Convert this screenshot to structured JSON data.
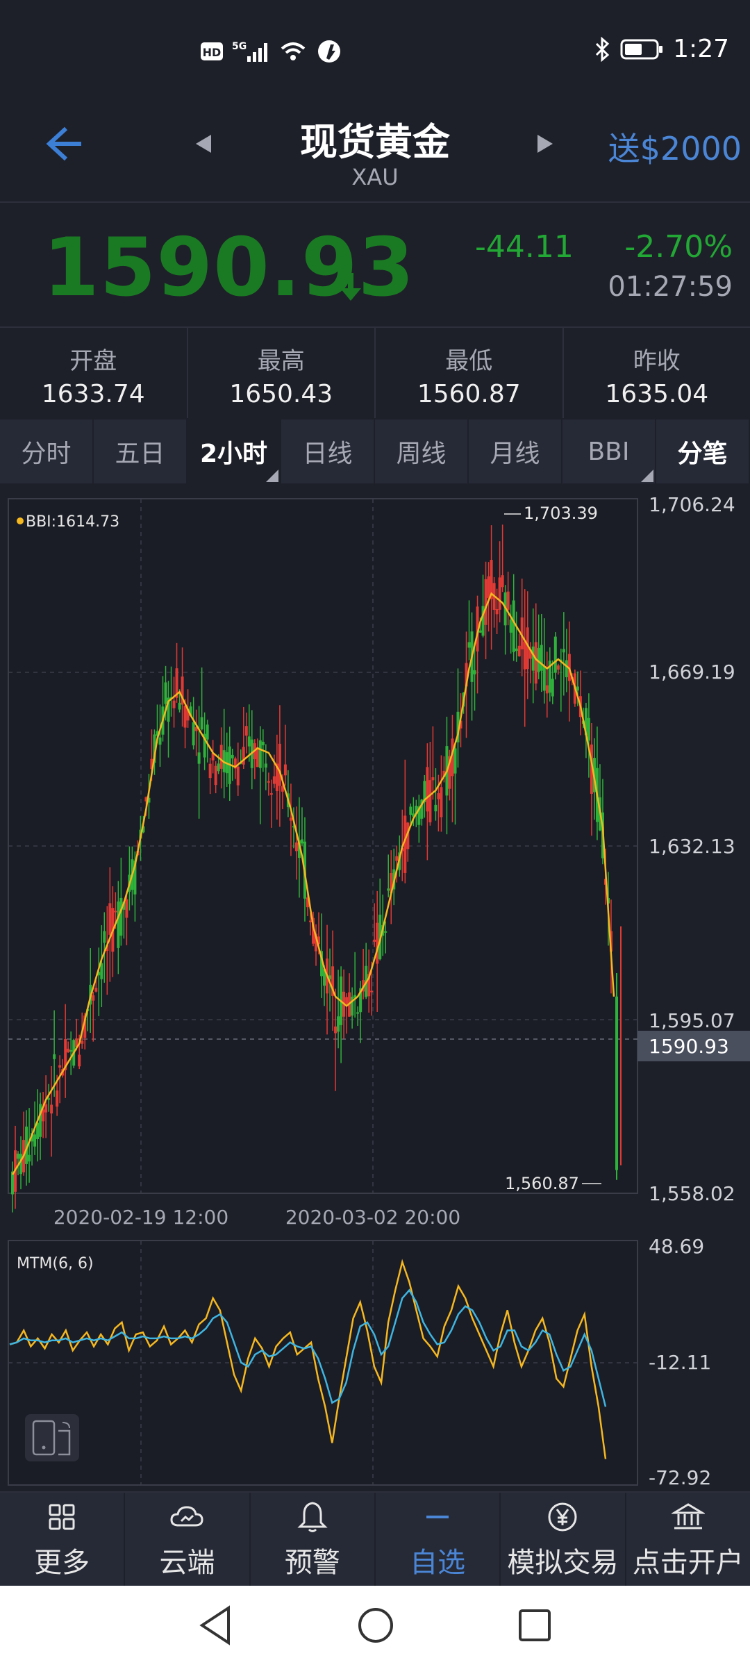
{
  "status_bar": {
    "left_icons": [
      "hd-icon",
      "5g-signal-icon",
      "wifi-icon",
      "app-notification-icon"
    ],
    "time": "1:27"
  },
  "header": {
    "title": "现货黄金",
    "subtitle": "XAU",
    "promo": "送$2000"
  },
  "quote": {
    "price": "1590.93",
    "change": "-44.11",
    "change_percent": "-2.70%",
    "time": "01:27:59",
    "down_color": "#1a7a23"
  },
  "stats": [
    {
      "label": "开盘",
      "value": "1633.74"
    },
    {
      "label": "最高",
      "value": "1650.43"
    },
    {
      "label": "最低",
      "value": "1560.87"
    },
    {
      "label": "昨收",
      "value": "1635.04"
    }
  ],
  "tabs": [
    {
      "label": "分时"
    },
    {
      "label": "五日"
    },
    {
      "label": "2小时"
    },
    {
      "label": "日线"
    },
    {
      "label": "周线"
    },
    {
      "label": "月线"
    },
    {
      "label": "BBI"
    },
    {
      "label": "分笔"
    }
  ],
  "chart_data": [
    {
      "type": "candlestick",
      "legend": "BBI:1614.73",
      "ylim": [
        1558.02,
        1706.24
      ],
      "y_ticks": [
        "1,706.24",
        "1,669.19",
        "1,632.13",
        "1,595.07",
        "1,558.02"
      ],
      "x_ticks": [
        "2020-02-19 12:00",
        "2020-03-02 20:00"
      ],
      "current_price_label": "1590.93",
      "high_annotation": "1,703.39",
      "low_annotation": "1,560.87",
      "bbi_series": [
        1562,
        1566,
        1572,
        1578,
        1582,
        1586,
        1590,
        1600,
        1608,
        1614,
        1620,
        1628,
        1640,
        1655,
        1663,
        1665,
        1660,
        1656,
        1652,
        1650,
        1649,
        1651,
        1653,
        1652,
        1648,
        1640,
        1630,
        1615,
        1606,
        1600,
        1598,
        1600,
        1604,
        1612,
        1622,
        1632,
        1638,
        1642,
        1644,
        1648,
        1656,
        1670,
        1680,
        1686,
        1684,
        1680,
        1676,
        1672,
        1670,
        1672,
        1670,
        1662,
        1650,
        1636,
        1600
      ],
      "colors": {
        "up": "#e03a35",
        "down": "#2fb13b",
        "bbi": "#f5b820"
      }
    },
    {
      "type": "line",
      "indicator": "MTM(6, 6)",
      "ylim": [
        -72.92,
        48.69
      ],
      "y_ticks": [
        "48.69",
        "-12.11",
        "-72.92"
      ],
      "series": [
        {
          "name": "MTM",
          "color": "#f5b820",
          "values": [
            -3,
            -2,
            4,
            -4,
            0,
            -5,
            2,
            -2,
            4,
            -6,
            -1,
            3,
            -4,
            2,
            -3,
            5,
            8,
            -6,
            2,
            3,
            -4,
            -1,
            6,
            -3,
            0,
            4,
            -2,
            7,
            10,
            20,
            14,
            -2,
            -18,
            -26,
            -10,
            0,
            -5,
            -14,
            -4,
            0,
            3,
            -8,
            -5,
            -2,
            -20,
            -34,
            -52,
            -30,
            -10,
            10,
            18,
            4,
            -14,
            -22,
            8,
            24,
            38,
            28,
            14,
            0,
            -4,
            -9,
            6,
            14,
            26,
            20,
            10,
            2,
            -6,
            -14,
            2,
            14,
            -2,
            -14,
            -6,
            4,
            10,
            -2,
            -20,
            -24,
            -10,
            4,
            12,
            -14,
            -34,
            -60
          ]
        },
        {
          "name": "MAMTM",
          "color": "#3fb5e0",
          "values": [
            -3,
            -2,
            0,
            -1,
            -1,
            -2,
            -1,
            -1,
            0,
            -2,
            -1,
            0,
            -1,
            0,
            -1,
            1,
            3,
            0,
            0,
            1,
            0,
            0,
            1,
            0,
            0,
            1,
            0,
            2,
            5,
            10,
            12,
            8,
            -2,
            -12,
            -14,
            -8,
            -6,
            -9,
            -8,
            -5,
            -2,
            -4,
            -5,
            -4,
            -10,
            -20,
            -32,
            -30,
            -22,
            -6,
            6,
            8,
            2,
            -8,
            -4,
            8,
            20,
            24,
            18,
            8,
            2,
            -3,
            -2,
            4,
            12,
            16,
            14,
            8,
            0,
            -6,
            -4,
            4,
            4,
            -4,
            -6,
            -2,
            4,
            2,
            -8,
            -16,
            -14,
            -6,
            2,
            -6,
            -20,
            -34
          ]
        }
      ]
    }
  ],
  "bottom_nav": [
    {
      "label": "更多",
      "icon": "grid-icon"
    },
    {
      "label": "云端",
      "icon": "cloud-icon"
    },
    {
      "label": "预警",
      "icon": "bell-icon"
    },
    {
      "label": "自选",
      "icon": "dash-icon"
    },
    {
      "label": "模拟交易",
      "icon": "yen-circle-icon"
    },
    {
      "label": "点击开户",
      "icon": "bank-icon"
    }
  ]
}
